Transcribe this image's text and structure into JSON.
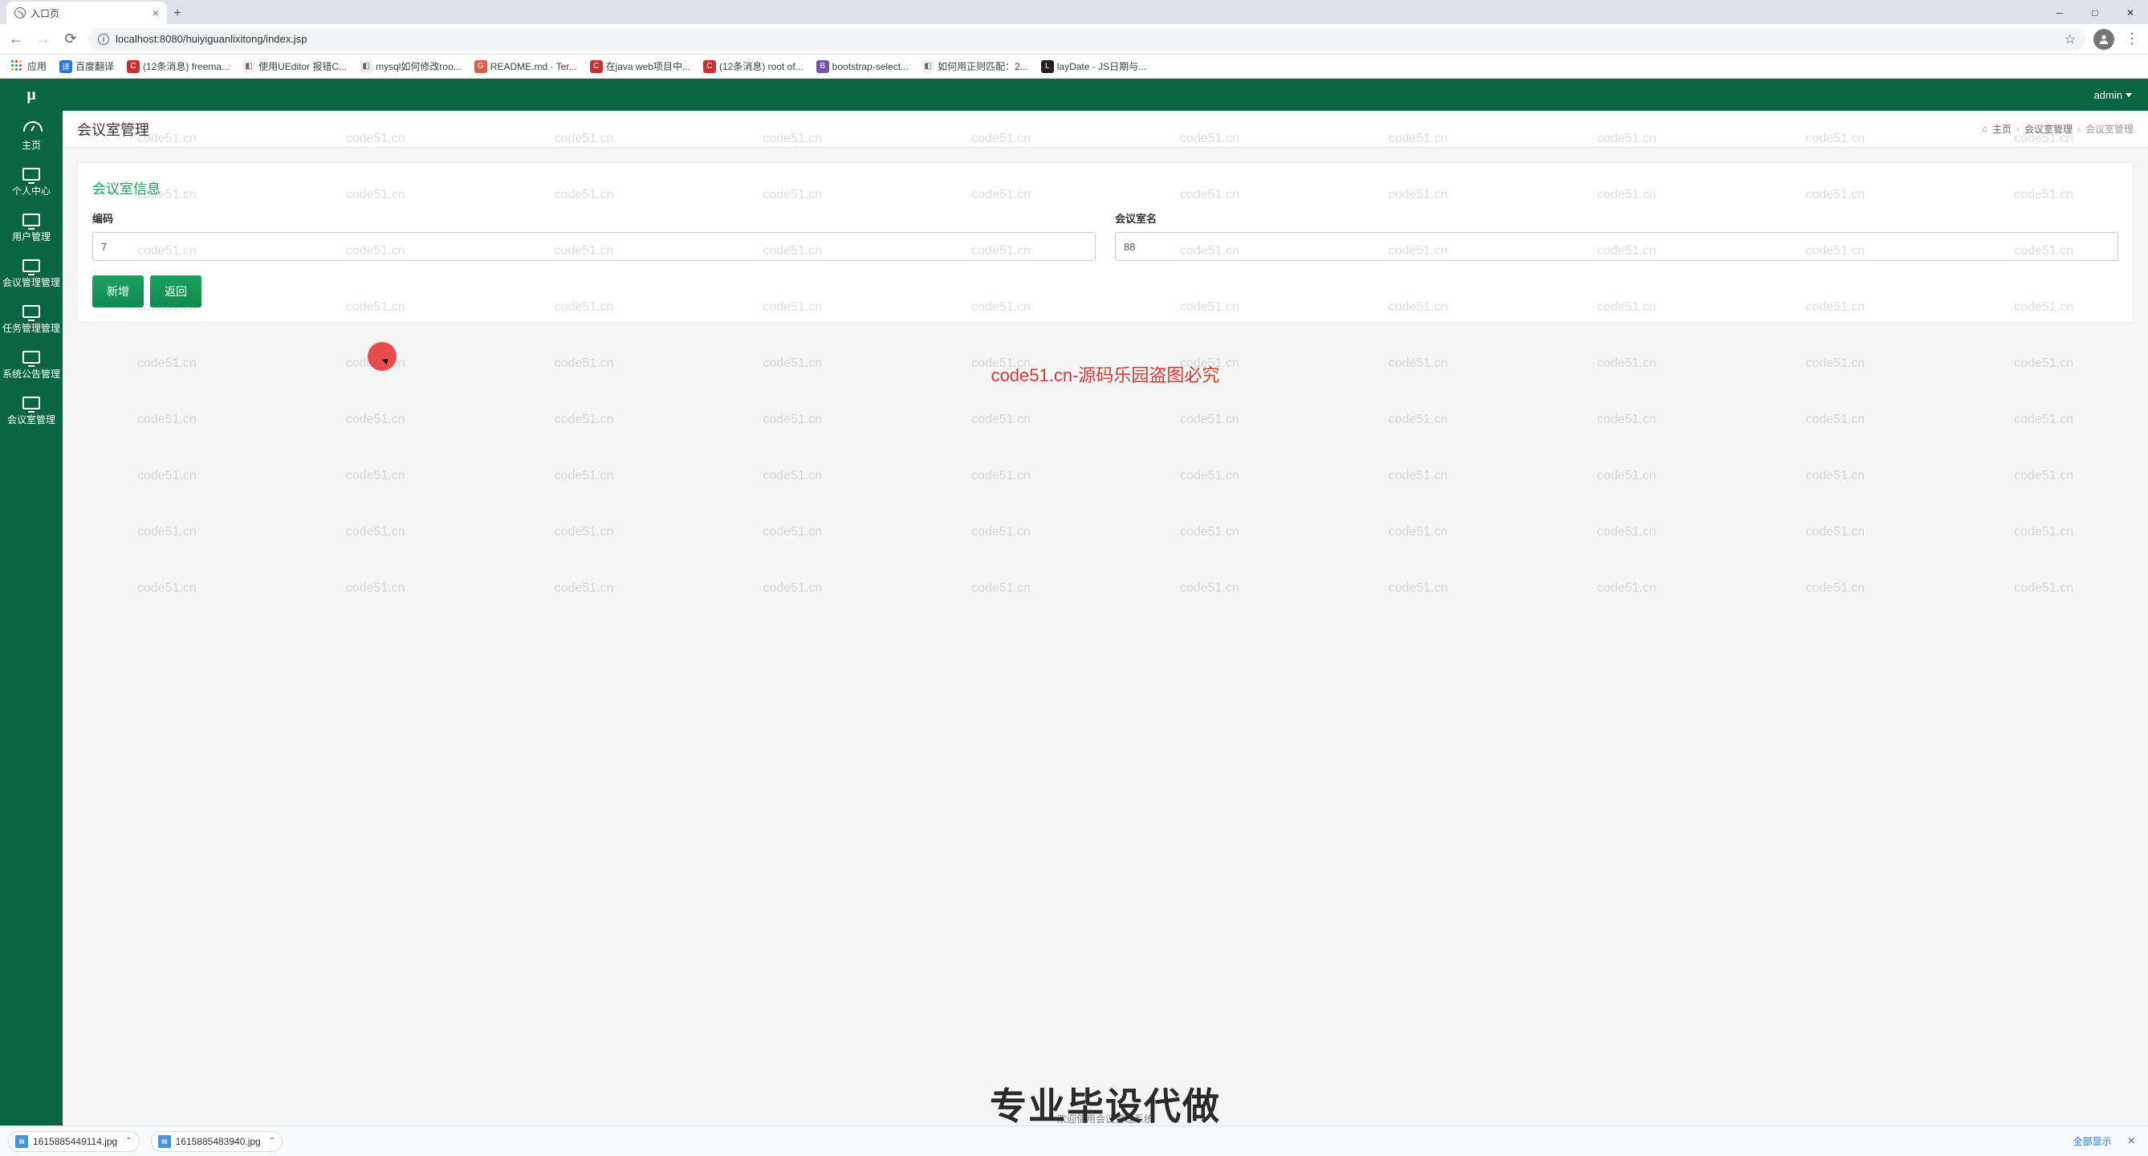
{
  "browser": {
    "tab_title": "入口页",
    "url": "localhost:8080/huiyiguanlixitong/index.jsp",
    "bookmarks": [
      {
        "label": "应用",
        "color": ""
      },
      {
        "label": "百度翻译",
        "color": "#2b72d9"
      },
      {
        "label": "(12条消息) freema...",
        "color": "#c9302c"
      },
      {
        "label": "使用UEditor 报错C...",
        "color": "#666"
      },
      {
        "label": "mysql如何修改roo...",
        "color": "#666"
      },
      {
        "label": "README.md · Ter...",
        "color": "#e05d44"
      },
      {
        "label": "在java web项目中...",
        "color": "#c9302c"
      },
      {
        "label": "(12条消息) root of...",
        "color": "#c9302c"
      },
      {
        "label": "bootstrap-select...",
        "color": "#7a4fb5"
      },
      {
        "label": "如何用正则匹配：2...",
        "color": "#666"
      },
      {
        "label": "layDate - JS日期与...",
        "color": "#222"
      }
    ]
  },
  "header": {
    "logo": "μ",
    "user": "admin"
  },
  "sidebar": {
    "items": [
      {
        "label": "主页"
      },
      {
        "label": "个人中心"
      },
      {
        "label": "用户管理"
      },
      {
        "label": "会议管理管理"
      },
      {
        "label": "任务管理管理"
      },
      {
        "label": "系统公告管理"
      },
      {
        "label": "会议室管理"
      }
    ]
  },
  "page": {
    "title": "会议室管理",
    "breadcrumb": {
      "home": "主页",
      "mid": "会议室管理",
      "current": "会议室管理"
    },
    "card_title": "会议室信息",
    "form": {
      "code_label": "编码",
      "code_value": "7",
      "name_label": "会议室名",
      "name_value": "88"
    },
    "buttons": {
      "add": "新增",
      "back": "返回"
    },
    "footer_welcome": "欢迎使用会议管理系统"
  },
  "overlay": {
    "watermark": "code51.cn",
    "red_banner": "code51.cn-源码乐园盗图必究",
    "big_text": "专业毕设代做"
  },
  "downloads": {
    "items": [
      "1615885449114.jpg",
      "1615885483940.jpg"
    ],
    "show_all": "全部显示"
  }
}
